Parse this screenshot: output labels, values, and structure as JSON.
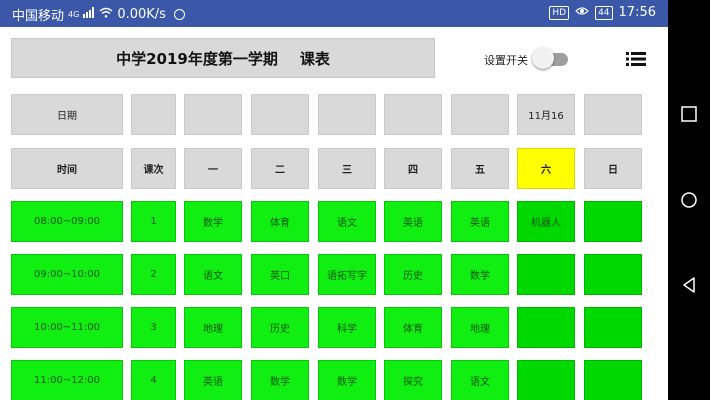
{
  "status_bar": {
    "carrier": "中国移动",
    "network": "4G",
    "speed": "0.00K/s",
    "hd": "HD",
    "battery": "44",
    "time": "17:56"
  },
  "header": {
    "title": "中学2019年度第一学期",
    "subtitle": "课表",
    "switch_label": "设置开关",
    "switch_on": false
  },
  "date_row": [
    "日期",
    "",
    "",
    "",
    "",
    "",
    "",
    "11月16",
    ""
  ],
  "weekday_header": {
    "time": "时间",
    "period": "课次",
    "days": [
      "一",
      "二",
      "三",
      "四",
      "五",
      "六",
      "日"
    ],
    "highlight_day": "六"
  },
  "schedule": [
    {
      "time": "08:00~09:00",
      "period": "1",
      "courses": [
        "数学",
        "体育",
        "语文",
        "英语",
        "英语",
        "机器人",
        ""
      ]
    },
    {
      "time": "09:00~10:00",
      "period": "2",
      "courses": [
        "语文",
        "英口",
        "语拓写字",
        "历史",
        "数学",
        "",
        ""
      ]
    },
    {
      "time": "10:00~11:00",
      "period": "3",
      "courses": [
        "地理",
        "历史",
        "科学",
        "体育",
        "地理",
        "",
        ""
      ]
    },
    {
      "time": "11:00~12:00",
      "period": "4",
      "courses": [
        "英语",
        "数学",
        "数学",
        "探究",
        "语文",
        "",
        ""
      ]
    }
  ],
  "icons": {
    "menu": "menu-list-icon",
    "wifi": "wifi-icon",
    "signal": "signal-icon",
    "eye": "eye-icon",
    "sync": "sync-icon"
  },
  "colors": {
    "status_bar": "#3a57a8",
    "cell_gray": "#d9d9d9",
    "cell_green": "#11ee11",
    "cell_green_weekend": "#00d900",
    "highlight": "#ffff00"
  }
}
